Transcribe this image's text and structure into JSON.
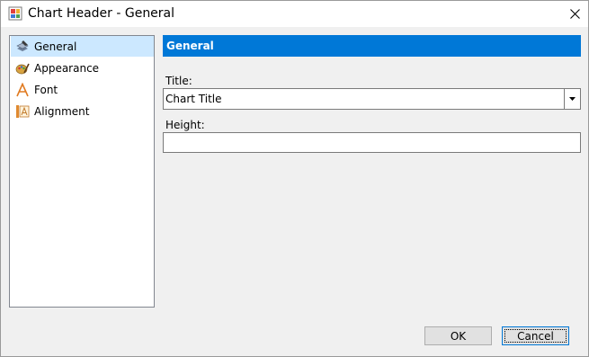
{
  "window": {
    "title": "Chart Header - General",
    "icon": "chart-app-icon",
    "close_icon": "close-icon"
  },
  "sidebar": {
    "items": [
      {
        "label": "General",
        "icon": "general-icon",
        "selected": true
      },
      {
        "label": "Appearance",
        "icon": "appearance-icon",
        "selected": false
      },
      {
        "label": "Font",
        "icon": "font-icon",
        "selected": false
      },
      {
        "label": "Alignment",
        "icon": "alignment-icon",
        "selected": false
      }
    ]
  },
  "main": {
    "section_title": "General",
    "title_field": {
      "label": "Title:",
      "value": "Chart Title"
    },
    "height_field": {
      "label": "Height:",
      "value": ""
    }
  },
  "buttons": {
    "ok_label": "OK",
    "cancel_label": "Cancel"
  },
  "colors": {
    "accent": "#0078d7",
    "selection": "#cce8ff",
    "dialog_bg": "#f0f0f0"
  }
}
